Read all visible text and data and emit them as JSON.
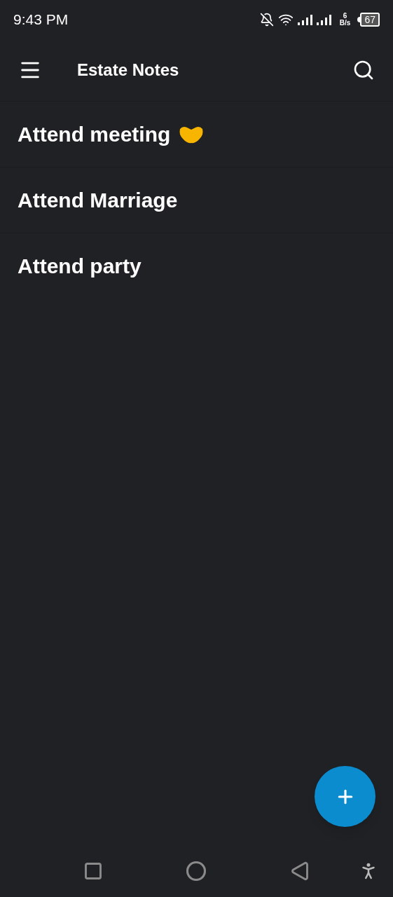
{
  "status_bar": {
    "time": "9:43 PM",
    "speed_value": "6",
    "speed_unit": "B/s",
    "battery": "67"
  },
  "app_bar": {
    "title": "Estate Notes"
  },
  "notes": [
    {
      "title": "Attend meeting",
      "kind": "emoji"
    },
    {
      "title": "Attend Marriage",
      "kind": "plain"
    },
    {
      "title": "Attend party",
      "kind": "plain"
    }
  ]
}
